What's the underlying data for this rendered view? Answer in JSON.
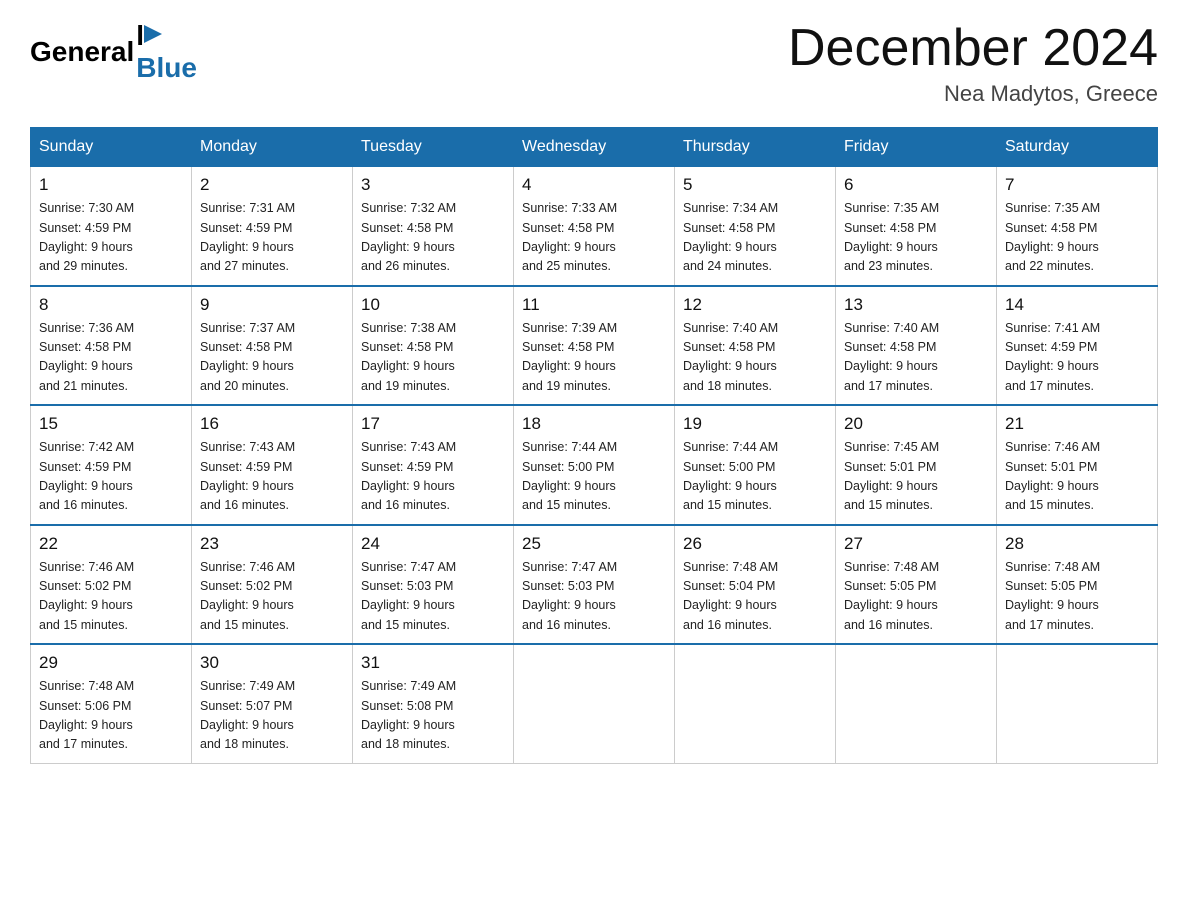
{
  "logo": {
    "general": "General",
    "arrow": "▶",
    "blue": "Blue"
  },
  "title": {
    "month_year": "December 2024",
    "location": "Nea Madytos, Greece"
  },
  "headers": [
    "Sunday",
    "Monday",
    "Tuesday",
    "Wednesday",
    "Thursday",
    "Friday",
    "Saturday"
  ],
  "weeks": [
    [
      {
        "day": "1",
        "info": "Sunrise: 7:30 AM\nSunset: 4:59 PM\nDaylight: 9 hours\nand 29 minutes."
      },
      {
        "day": "2",
        "info": "Sunrise: 7:31 AM\nSunset: 4:59 PM\nDaylight: 9 hours\nand 27 minutes."
      },
      {
        "day": "3",
        "info": "Sunrise: 7:32 AM\nSunset: 4:58 PM\nDaylight: 9 hours\nand 26 minutes."
      },
      {
        "day": "4",
        "info": "Sunrise: 7:33 AM\nSunset: 4:58 PM\nDaylight: 9 hours\nand 25 minutes."
      },
      {
        "day": "5",
        "info": "Sunrise: 7:34 AM\nSunset: 4:58 PM\nDaylight: 9 hours\nand 24 minutes."
      },
      {
        "day": "6",
        "info": "Sunrise: 7:35 AM\nSunset: 4:58 PM\nDaylight: 9 hours\nand 23 minutes."
      },
      {
        "day": "7",
        "info": "Sunrise: 7:35 AM\nSunset: 4:58 PM\nDaylight: 9 hours\nand 22 minutes."
      }
    ],
    [
      {
        "day": "8",
        "info": "Sunrise: 7:36 AM\nSunset: 4:58 PM\nDaylight: 9 hours\nand 21 minutes."
      },
      {
        "day": "9",
        "info": "Sunrise: 7:37 AM\nSunset: 4:58 PM\nDaylight: 9 hours\nand 20 minutes."
      },
      {
        "day": "10",
        "info": "Sunrise: 7:38 AM\nSunset: 4:58 PM\nDaylight: 9 hours\nand 19 minutes."
      },
      {
        "day": "11",
        "info": "Sunrise: 7:39 AM\nSunset: 4:58 PM\nDaylight: 9 hours\nand 19 minutes."
      },
      {
        "day": "12",
        "info": "Sunrise: 7:40 AM\nSunset: 4:58 PM\nDaylight: 9 hours\nand 18 minutes."
      },
      {
        "day": "13",
        "info": "Sunrise: 7:40 AM\nSunset: 4:58 PM\nDaylight: 9 hours\nand 17 minutes."
      },
      {
        "day": "14",
        "info": "Sunrise: 7:41 AM\nSunset: 4:59 PM\nDaylight: 9 hours\nand 17 minutes."
      }
    ],
    [
      {
        "day": "15",
        "info": "Sunrise: 7:42 AM\nSunset: 4:59 PM\nDaylight: 9 hours\nand 16 minutes."
      },
      {
        "day": "16",
        "info": "Sunrise: 7:43 AM\nSunset: 4:59 PM\nDaylight: 9 hours\nand 16 minutes."
      },
      {
        "day": "17",
        "info": "Sunrise: 7:43 AM\nSunset: 4:59 PM\nDaylight: 9 hours\nand 16 minutes."
      },
      {
        "day": "18",
        "info": "Sunrise: 7:44 AM\nSunset: 5:00 PM\nDaylight: 9 hours\nand 15 minutes."
      },
      {
        "day": "19",
        "info": "Sunrise: 7:44 AM\nSunset: 5:00 PM\nDaylight: 9 hours\nand 15 minutes."
      },
      {
        "day": "20",
        "info": "Sunrise: 7:45 AM\nSunset: 5:01 PM\nDaylight: 9 hours\nand 15 minutes."
      },
      {
        "day": "21",
        "info": "Sunrise: 7:46 AM\nSunset: 5:01 PM\nDaylight: 9 hours\nand 15 minutes."
      }
    ],
    [
      {
        "day": "22",
        "info": "Sunrise: 7:46 AM\nSunset: 5:02 PM\nDaylight: 9 hours\nand 15 minutes."
      },
      {
        "day": "23",
        "info": "Sunrise: 7:46 AM\nSunset: 5:02 PM\nDaylight: 9 hours\nand 15 minutes."
      },
      {
        "day": "24",
        "info": "Sunrise: 7:47 AM\nSunset: 5:03 PM\nDaylight: 9 hours\nand 15 minutes."
      },
      {
        "day": "25",
        "info": "Sunrise: 7:47 AM\nSunset: 5:03 PM\nDaylight: 9 hours\nand 16 minutes."
      },
      {
        "day": "26",
        "info": "Sunrise: 7:48 AM\nSunset: 5:04 PM\nDaylight: 9 hours\nand 16 minutes."
      },
      {
        "day": "27",
        "info": "Sunrise: 7:48 AM\nSunset: 5:05 PM\nDaylight: 9 hours\nand 16 minutes."
      },
      {
        "day": "28",
        "info": "Sunrise: 7:48 AM\nSunset: 5:05 PM\nDaylight: 9 hours\nand 17 minutes."
      }
    ],
    [
      {
        "day": "29",
        "info": "Sunrise: 7:48 AM\nSunset: 5:06 PM\nDaylight: 9 hours\nand 17 minutes."
      },
      {
        "day": "30",
        "info": "Sunrise: 7:49 AM\nSunset: 5:07 PM\nDaylight: 9 hours\nand 18 minutes."
      },
      {
        "day": "31",
        "info": "Sunrise: 7:49 AM\nSunset: 5:08 PM\nDaylight: 9 hours\nand 18 minutes."
      },
      {
        "day": "",
        "info": ""
      },
      {
        "day": "",
        "info": ""
      },
      {
        "day": "",
        "info": ""
      },
      {
        "day": "",
        "info": ""
      }
    ]
  ]
}
